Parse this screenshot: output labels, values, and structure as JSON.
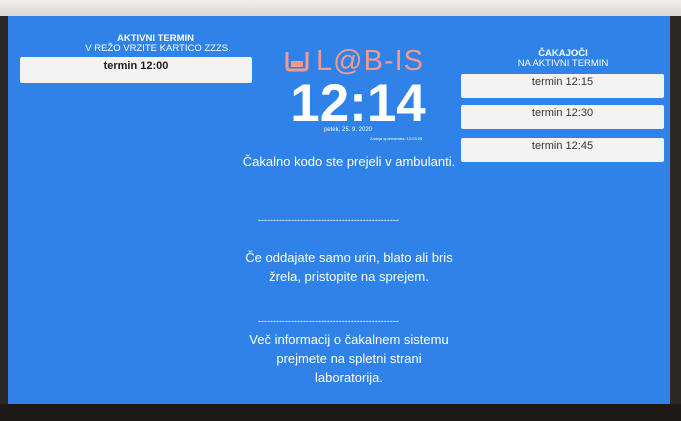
{
  "left_panel": {
    "title": "AKTIVNI TERMIN",
    "subtitle": "V REŽO VRZITE KARTICO ZZZS.",
    "active_slot": "termin 12:00"
  },
  "logo": {
    "text": "L@B-IS",
    "icon": "cup-icon"
  },
  "clock": {
    "time": "12:14",
    "date": "petek, 25. 9. 2020",
    "last_change": "Zadnja sprememba: 12:03:28"
  },
  "messages": {
    "msg1": "Čakalno kodo ste prejeli v ambulanti.",
    "msg2": "Če oddajate samo urin, blato ali bris žrela, pristopite na sprejem.",
    "msg3": "Več informacij o čakalnem sistemu prejmete na spletni strani laboratorija.",
    "divider": "-----------------------------------------------"
  },
  "right_panel": {
    "title": "ČAKAJOČI",
    "subtitle": "NA AKTIVNI TERMIN",
    "slots": [
      "termin 12:15",
      "termin 12:30",
      "termin 12:45"
    ]
  },
  "colors": {
    "screen_bg": "#2e82e8",
    "logo": "#f19a8d",
    "card_bg": "#f3f3f3"
  }
}
